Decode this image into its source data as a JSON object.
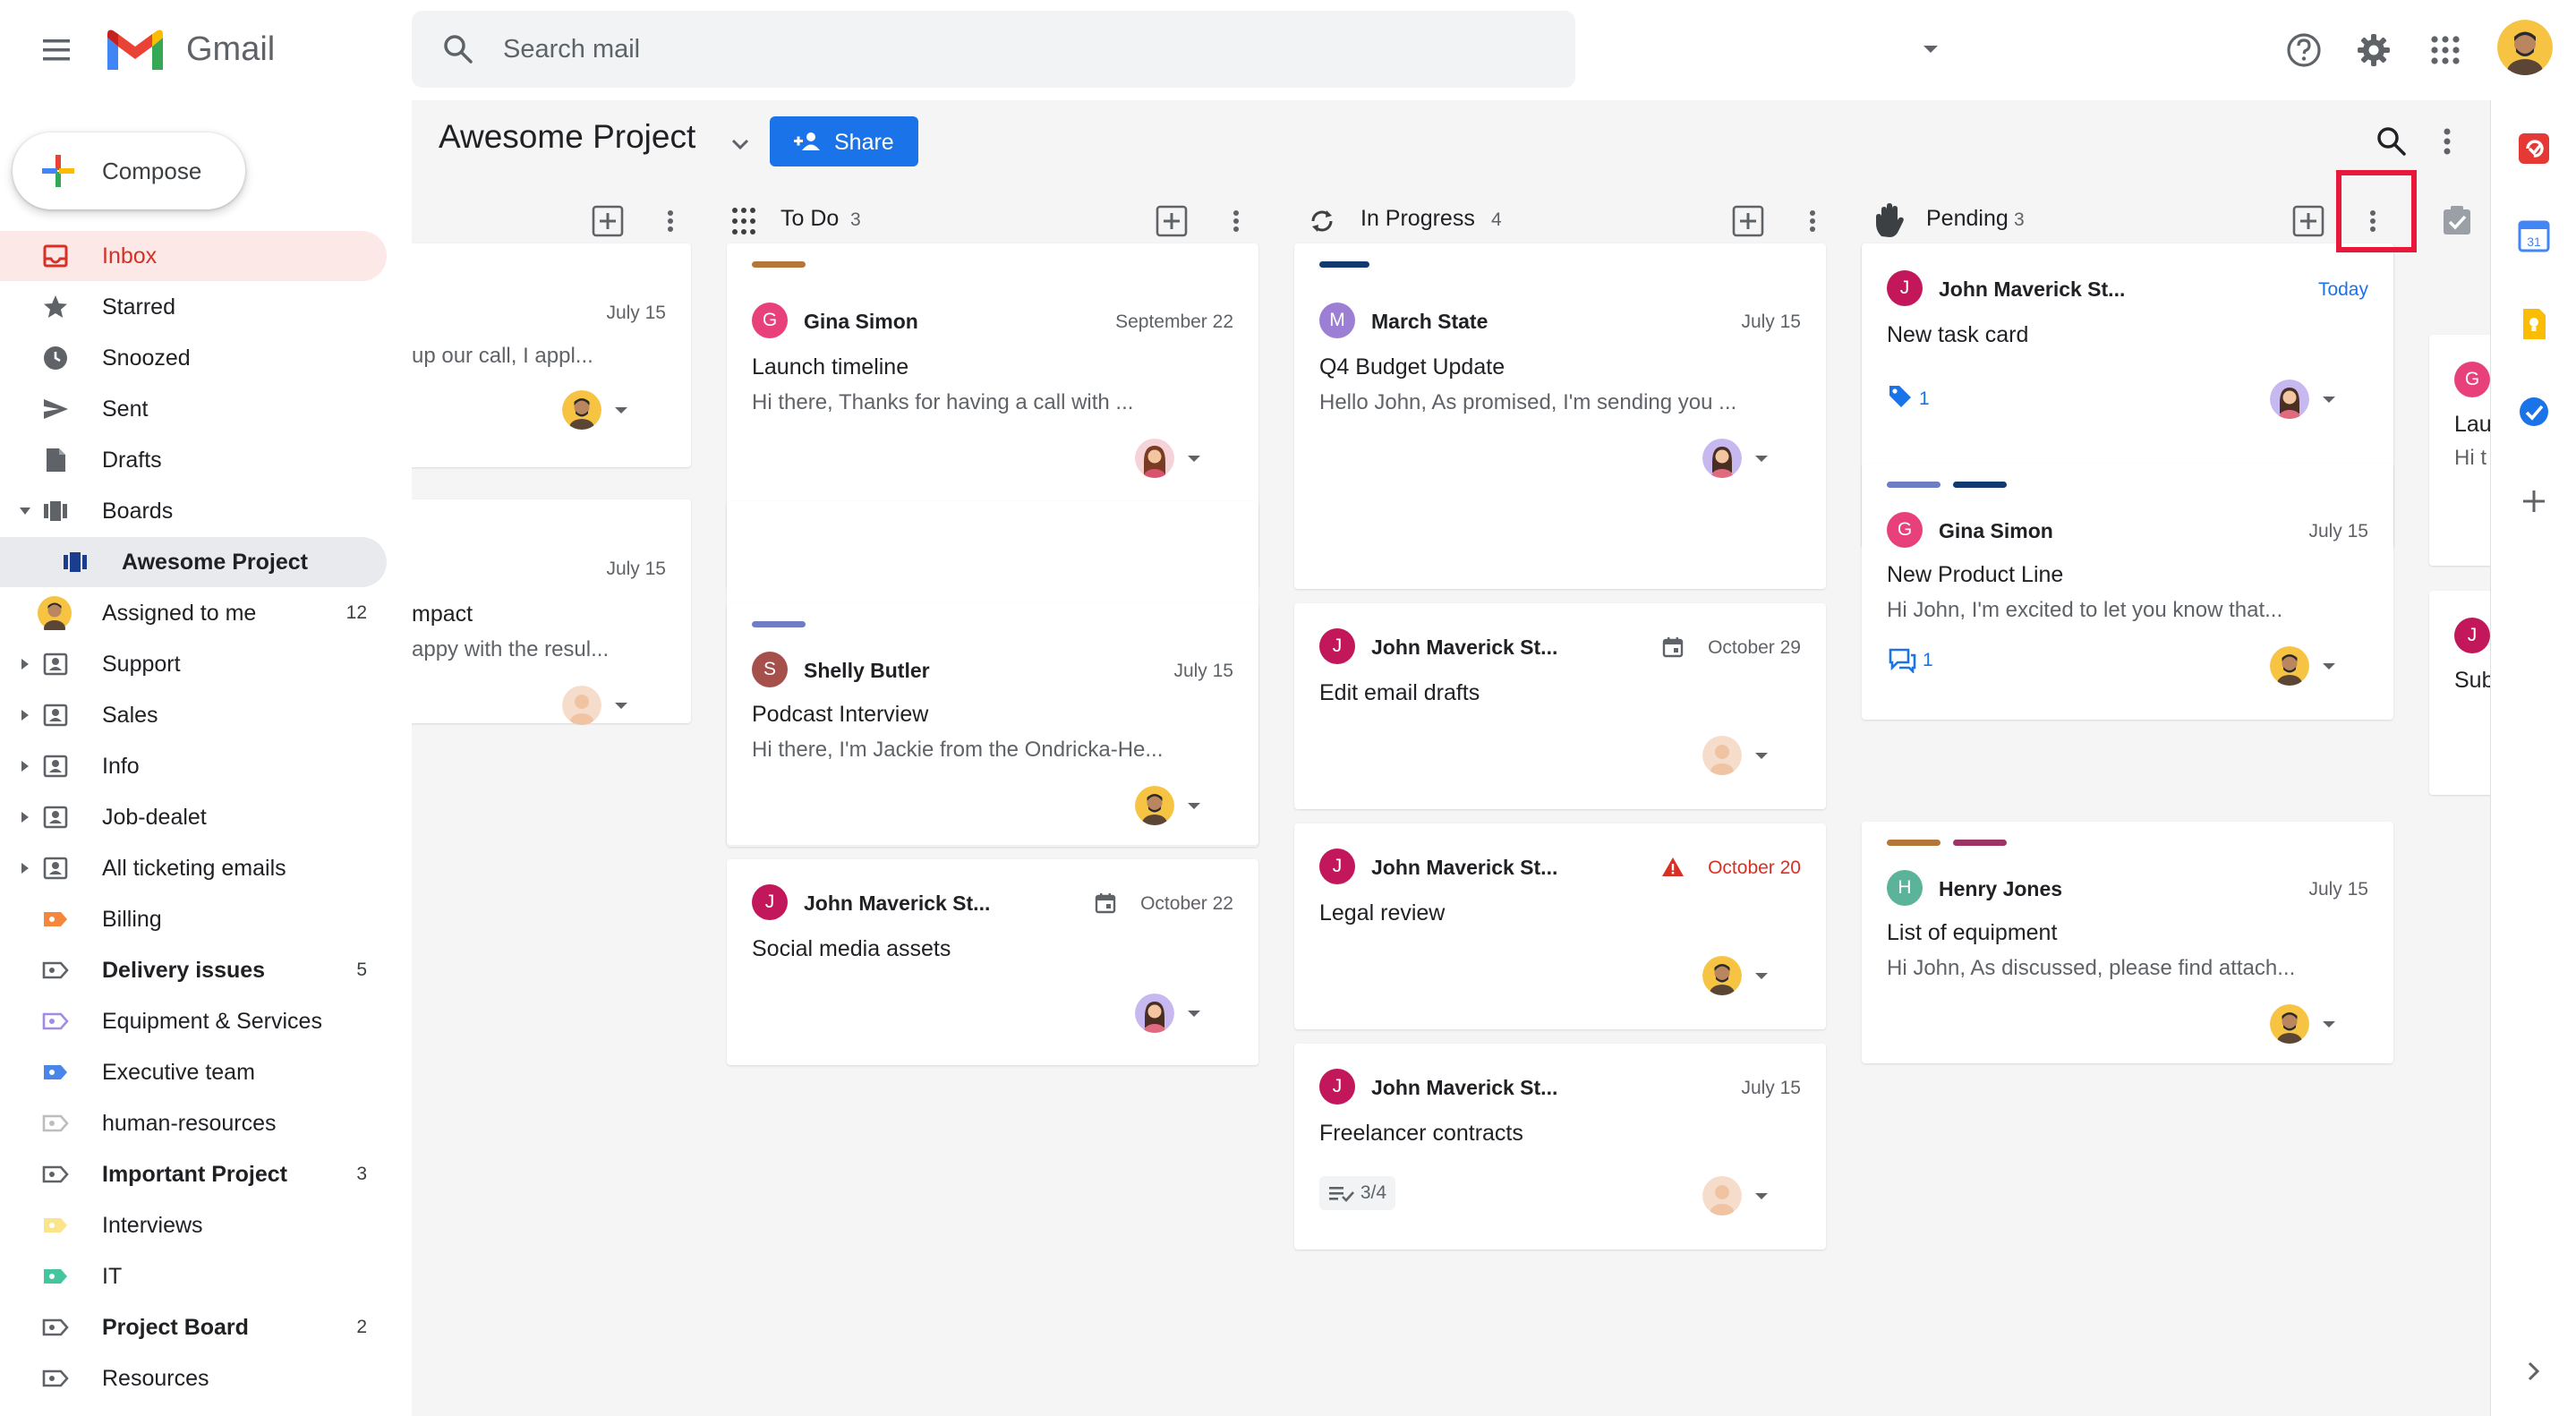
{
  "app": {
    "name": "Gmail"
  },
  "search": {
    "placeholder": "Search mail"
  },
  "compose": {
    "label": "Compose"
  },
  "nav": [
    {
      "label": "Inbox",
      "icon": "inbox-icon",
      "count": ""
    },
    {
      "label": "Starred",
      "icon": "star-icon",
      "count": ""
    },
    {
      "label": "Snoozed",
      "icon": "clock-icon",
      "count": ""
    },
    {
      "label": "Sent",
      "icon": "send-icon",
      "count": ""
    },
    {
      "label": "Drafts",
      "icon": "draft-icon",
      "count": ""
    },
    {
      "label": "Boards",
      "icon": "board-icon",
      "count": ""
    },
    {
      "label": "Awesome Project",
      "icon": "board-icon",
      "count": ""
    },
    {
      "label": "Assigned to me",
      "icon": "avatar-icon",
      "count": "12"
    },
    {
      "label": "Support",
      "icon": "shared-label-icon",
      "count": ""
    },
    {
      "label": "Sales",
      "icon": "shared-label-icon",
      "count": ""
    },
    {
      "label": "Info",
      "icon": "shared-label-icon",
      "count": ""
    },
    {
      "label": "Job-dealet",
      "icon": "shared-label-icon",
      "count": ""
    },
    {
      "label": "All ticketing emails",
      "icon": "shared-label-icon",
      "count": ""
    },
    {
      "label": "Billing",
      "icon": "label-icon",
      "count": ""
    },
    {
      "label": "Delivery issues",
      "icon": "label-icon",
      "count": "5"
    },
    {
      "label": "Equipment & Services",
      "icon": "label-icon",
      "count": ""
    },
    {
      "label": "Executive team",
      "icon": "label-icon",
      "count": ""
    },
    {
      "label": "human-resources",
      "icon": "label-icon",
      "count": ""
    },
    {
      "label": "Important Project",
      "icon": "label-icon",
      "count": "3"
    },
    {
      "label": "Interviews",
      "icon": "label-icon",
      "count": ""
    },
    {
      "label": "IT",
      "icon": "label-icon",
      "count": ""
    },
    {
      "label": "Project Board",
      "icon": "label-icon",
      "count": "2"
    },
    {
      "label": "Resources",
      "icon": "label-icon",
      "count": ""
    }
  ],
  "board": {
    "title": "Awesome Project",
    "share_label": "Share"
  },
  "columns": [
    {
      "title": "",
      "count": ""
    },
    {
      "title": "To Do",
      "count": "3"
    },
    {
      "title": "In Progress",
      "count": "4"
    },
    {
      "title": "Pending",
      "count": "3"
    }
  ],
  "cards": {
    "c0a": {
      "date": "July 15",
      "snippet": "up our call, I appl..."
    },
    "c0b": {
      "date": "July 15",
      "subject": "mpact",
      "snippet": "appy with the resul..."
    },
    "c1a": {
      "initial": "G",
      "sender": "Gina Simon",
      "date": "September 22",
      "subject": "Launch timeline",
      "snippet": "Hi there, Thanks for having a call with ..."
    },
    "c1b": {
      "initial": "S",
      "sender": "Shelly Butler",
      "date": "July 15",
      "subject": "Podcast Interview",
      "snippet": "Hi there, I'm Jackie from the Ondricka-He..."
    },
    "c1c": {
      "initial": "J",
      "sender": "John Maverick St...",
      "date": "October 22",
      "subject": "Social media assets"
    },
    "c2a": {
      "initial": "M",
      "sender": "March State",
      "date": "July 15",
      "subject": "Q4 Budget Update",
      "snippet": "Hello John, As promised, I'm sending you ..."
    },
    "c2b": {
      "initial": "J",
      "sender": "John Maverick St...",
      "date": "October 29",
      "subject": "Edit email drafts"
    },
    "c2c": {
      "initial": "J",
      "sender": "John Maverick St...",
      "date": "October 20",
      "subject": "Legal review"
    },
    "c2d": {
      "initial": "J",
      "sender": "John Maverick St...",
      "date": "July 15",
      "subject": "Freelancer contracts",
      "checklist": "3/4"
    },
    "c3a": {
      "initial": "J",
      "sender": "John Maverick St...",
      "date": "Today",
      "subject": "New task card",
      "tag_count": "1"
    },
    "c3b": {
      "initial": "G",
      "sender": "Gina Simon",
      "date": "July 15",
      "subject": "New Product Line",
      "snippet": "Hi John, I'm excited to let you know that...",
      "comment_count": "1"
    },
    "c3c": {
      "initial": "H",
      "sender": "Henry Jones",
      "date": "July 15",
      "subject": "List of equipment",
      "snippet": "Hi John, As discussed, please find attach..."
    },
    "c4a": {
      "initial": "G",
      "subject": "Lau",
      "snippet": "Hi t"
    },
    "c4b": {
      "initial": "J",
      "subject": "Sub"
    }
  },
  "colors": {
    "accent": "#1a73e8",
    "gmail_red": "#d93025",
    "overdue": "#d93025",
    "highlight": "#e8183a"
  }
}
